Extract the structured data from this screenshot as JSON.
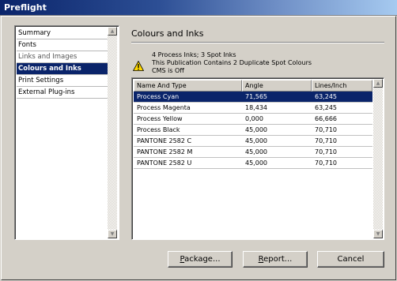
{
  "window": {
    "title": "Preflight"
  },
  "sidebar": {
    "items": [
      {
        "label": "Summary",
        "selected": false
      },
      {
        "label": "Fonts",
        "selected": false
      },
      {
        "label": "Links and Images",
        "selected": false
      },
      {
        "label": "Colours and Inks",
        "selected": true
      },
      {
        "label": "Print Settings",
        "selected": false
      },
      {
        "label": "External Plug-ins",
        "selected": false
      }
    ]
  },
  "main": {
    "title": "Colours and Inks",
    "summary": [
      "4 Process Inks; 3 Spot Inks",
      "This Publication Contains 2 Duplicate Spot Colours",
      "CMS is Off"
    ],
    "warning_icon": "warning-triangle-icon",
    "table": {
      "columns": [
        "Name And Type",
        "Angle",
        "Lines/Inch"
      ],
      "rows": [
        [
          "Process Cyan",
          "71,565",
          "63,245"
        ],
        [
          "Process Magenta",
          "18,434",
          "63,245"
        ],
        [
          "Process Yellow",
          "0,000",
          "66,666"
        ],
        [
          "Process Black",
          "45,000",
          "70,710"
        ],
        [
          "PANTONE 2582 C",
          "45,000",
          "70,710"
        ],
        [
          "PANTONE 2582 M",
          "45,000",
          "70,710"
        ],
        [
          "PANTONE 2582 U",
          "45,000",
          "70,710"
        ]
      ],
      "selected_row": 0
    }
  },
  "buttons": {
    "package": {
      "mnemonic": "P",
      "rest": "ackage..."
    },
    "report": {
      "mnemonic": "R",
      "rest": "eport..."
    },
    "cancel": "Cancel"
  },
  "colors": {
    "selection": "#0a246a",
    "dialog": "#d4d0c8"
  }
}
